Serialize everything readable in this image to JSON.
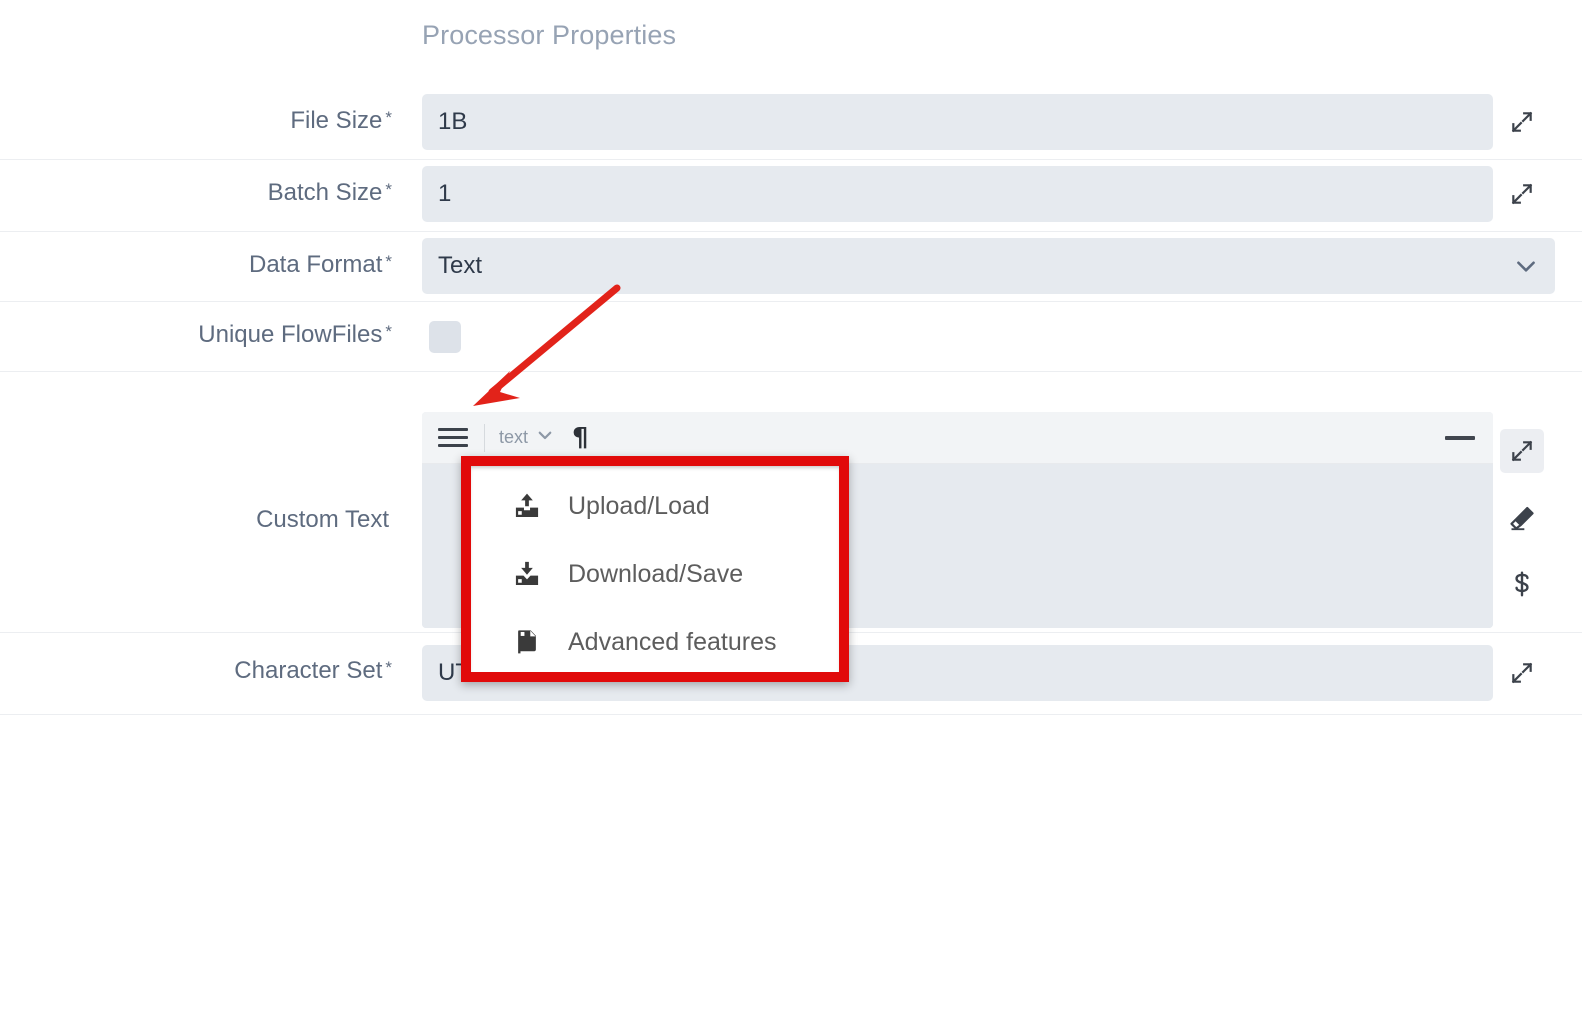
{
  "header": {
    "title": "Processor Properties"
  },
  "properties": [
    {
      "label": "File Size",
      "required": "*",
      "value": "1B",
      "control": "text",
      "action_icon": "expand-icon"
    },
    {
      "label": "Batch Size",
      "required": "*",
      "value": "1",
      "control": "text",
      "action_icon": "expand-icon"
    },
    {
      "label": "Data Format",
      "required": "*",
      "value": "Text",
      "control": "select",
      "action_icon": "chevron-down-icon"
    },
    {
      "label": "Unique FlowFiles",
      "required": "*",
      "value": "",
      "control": "checkbox",
      "checked": false
    },
    {
      "label": "Custom Text",
      "required": "",
      "value": "",
      "control": "rich-text-editor"
    },
    {
      "label": "Character Set",
      "required": "*",
      "value": "UTF-8",
      "control": "text",
      "action_icon": "expand-icon"
    }
  ],
  "editor": {
    "menu_icon": "hamburger-menu-icon",
    "mode_label": "text",
    "mode_chevron": "chevron-down-icon",
    "pilcrow": "¶",
    "minimize_label": "minimize-icon",
    "content": ""
  },
  "editor_menu": {
    "items": [
      {
        "label": "Upload/Load",
        "icon": "upload-icon"
      },
      {
        "label": "Download/Save",
        "icon": "download-icon"
      },
      {
        "label": "Advanced features",
        "icon": "document-icon"
      }
    ]
  },
  "side_actions": {
    "custom_text": [
      {
        "icon": "expand-icon",
        "active": true
      },
      {
        "icon": "eraser-icon",
        "active": false
      },
      {
        "icon": "dollar-icon",
        "active": false
      }
    ]
  },
  "colors": {
    "annotation_red": "#e10a0a",
    "field_background": "#e6eaef",
    "label_text": "#5e6b7f",
    "title_text": "#97a3b4",
    "value_text": "#2f3a4a"
  }
}
